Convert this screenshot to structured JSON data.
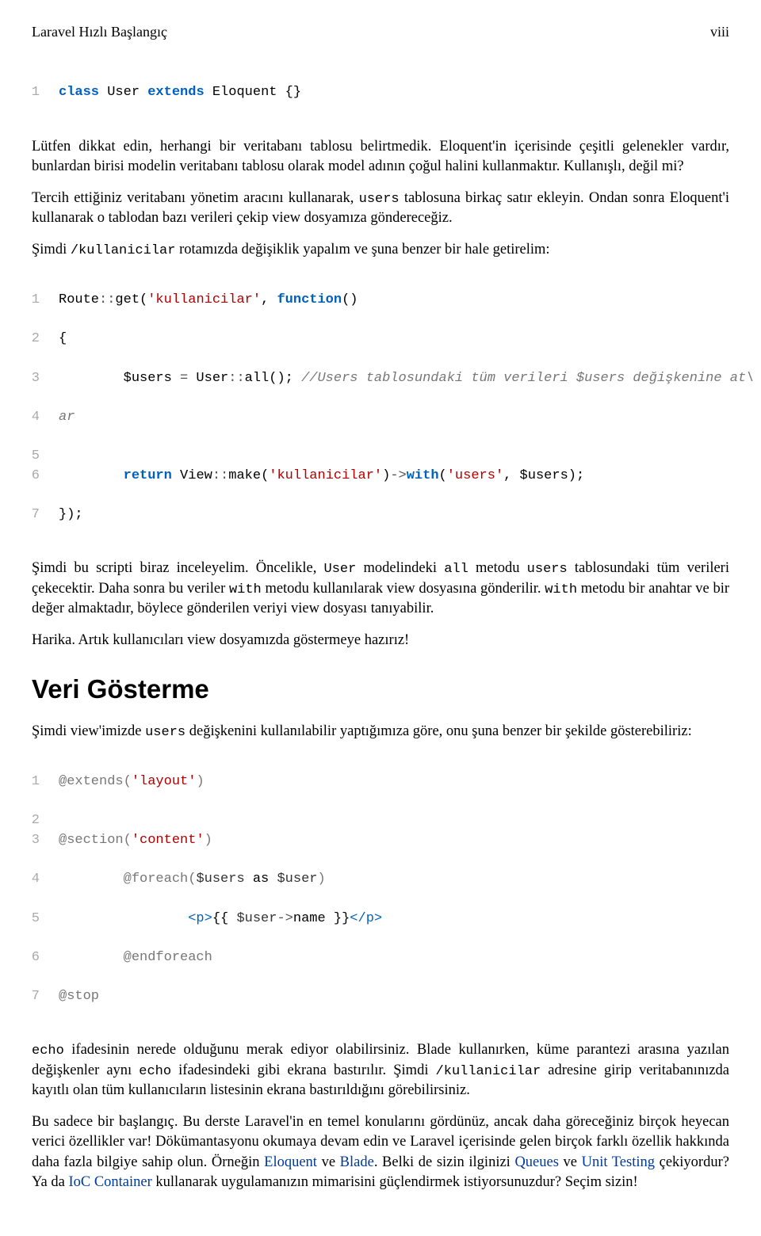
{
  "header": {
    "title": "Laravel Hızlı Başlangıç",
    "page": "viii"
  },
  "code1": {
    "ln1": "1",
    "kw_class": "class",
    "cls_user": " User ",
    "kw_extends": "extends",
    "cls_eloquent": " Eloquent {}"
  },
  "p1a": "Lütfen dikkat edin, herhangi bir veritabanı tablosu belirtmedik. Eloquent'in içerisinde çeşitli gelenekler vardır, bunlardan birisi modelin veritabanı tablosu olarak model adının çoğul halini kullanmaktır. Kullanışlı, değil mi?",
  "p1b_a": "Tercih ettiğiniz veritabanı yönetim aracını kullanarak, ",
  "p1b_code": "users",
  "p1b_b": " tablosuna birkaç satır ekleyin. Ondan sonra Eloquent'i kullanarak o tablodan bazı verileri çekip view dosyamıza göndereceğiz.",
  "p1c_a": "Şimdi ",
  "p1c_code": "/kullanicilar",
  "p1c_b": " rotamızda değişiklik yapalım ve şuna benzer bir hale getirelim:",
  "code2": {
    "ln": [
      "1",
      "2",
      "3",
      "4",
      "5",
      "6",
      "7"
    ],
    "l1_a": "Route",
    "l1_op1": "::",
    "l1_b": "get(",
    "l1_str": "'kullanicilar'",
    "l1_c": ", ",
    "l1_func": "function",
    "l1_d": "()",
    "l2": "{",
    "l3_a": "        $users ",
    "l3_op": "=",
    "l3_b": " User",
    "l3_op2": "::",
    "l3_c": "all(); ",
    "l3_comment": "//Users tablosundaki tüm verileri $users değişkenine at\\",
    "l4": "ar",
    "l5": "",
    "l6_a": "        ",
    "l6_return": "return",
    "l6_b": " View",
    "l6_op": "::",
    "l6_c": "make(",
    "l6_str1": "'kullanicilar'",
    "l6_d": ")",
    "l6_op2": "->",
    "l6_with": "with",
    "l6_e": "(",
    "l6_str2": "'users'",
    "l6_f": ", $users);",
    "l7": "});"
  },
  "p2_a": "Şimdi bu scripti biraz inceleyelim. Öncelikle, ",
  "p2_code1": "User",
  "p2_b": " modelindeki ",
  "p2_code2": "all",
  "p2_c": " metodu ",
  "p2_code3": "users",
  "p2_d": " tablosundaki tüm verileri çekecektir. Daha sonra bu veriler ",
  "p2_code4": "with",
  "p2_e": " metodu kullanılarak view dosyasına gönderilir. ",
  "p2_code5": "with",
  "p2_f": " metodu bir anahtar ve bir değer almaktadır, böylece gönderilen veriyi view dosyası tanıyabilir.",
  "p3": "Harika. Artık kullanıcıları view dosyamızda göstermeye hazırız!",
  "h2": "Veri Gösterme",
  "p4_a": "Şimdi view'imizde ",
  "p4_code": "users",
  "p4_b": " değişkenini kullanılabilir yaptığımıza göre, onu şuna benzer bir şekilde gösterebiliriz:",
  "code3": {
    "ln": [
      "1",
      "2",
      "3",
      "4",
      "5",
      "6",
      "7"
    ],
    "l1_a": "@extends(",
    "l1_str": "'layout'",
    "l1_b": ")",
    "l2": "",
    "l3_a": "@section(",
    "l3_str": "'content'",
    "l3_b": ")",
    "l4_a": "        @foreach(",
    "l4_v1": "$users",
    "l4_b": " as ",
    "l4_v2": "$user",
    "l4_c": ")",
    "l5_a": "                ",
    "l5_t1": "<p>",
    "l5_b": "{{ ",
    "l5_v": "$user",
    "l5_op": "->",
    "l5_c": "name }}",
    "l5_t2": "</p>",
    "l6": "        @endforeach",
    "l7": "@stop"
  },
  "p5_code1": "echo",
  "p5_a": " ifadesinin nerede olduğunu merak ediyor olabilirsiniz. Blade kullanırken, küme parantezi arasına yazılan değişkenler aynı ",
  "p5_code2": "echo",
  "p5_b": " ifadesindeki gibi ekrana bastırılır. Şimdi ",
  "p5_code3": "/kullanicilar",
  "p5_c": " adresine girip veritabanınızda kayıtlı olan tüm kullanıcıların listesinin ekrana bastırıldığını görebilirsiniz.",
  "p6_a": "Bu sadece bir başlangıç. Bu derste Laravel'in en temel konularını gördünüz, ancak daha göreceğiniz birçok heyecan verici özellikler var! Dökümantasyonu okumaya devam edin ve Laravel içerisinde gelen birçok farklı özellik hakkında daha fazla bilgiye sahip olun. Örneğin ",
  "p6_link1": "Eloquent",
  "p6_b": " ve ",
  "p6_link2": "Blade",
  "p6_c": ". Belki de sizin ilginizi ",
  "p6_link3": "Queues",
  "p6_d": " ve ",
  "p6_link4": "Unit Testing",
  "p6_e": " çekiyordur? Ya da ",
  "p6_link5": "IoC Container",
  "p6_f": " kullanarak uygulamanızın mimarisini güçlendirmek istiyorsunuzdur? Seçim sizin!"
}
